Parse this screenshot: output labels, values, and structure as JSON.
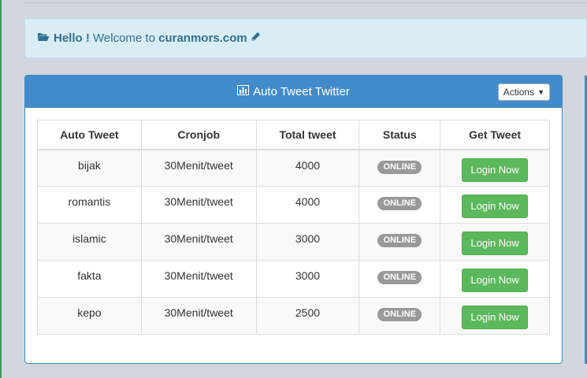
{
  "alert": {
    "hello": "Hello !",
    "welcome": "Welcome to",
    "site": "curanmors.com"
  },
  "panel": {
    "title": "Auto Tweet Twitter",
    "actions_label": "Actions"
  },
  "table": {
    "headers": [
      "Auto Tweet",
      "Cronjob",
      "Total tweet",
      "Status",
      "Get Tweet"
    ],
    "rows": [
      {
        "name": "bijak",
        "cron": "30Menit/tweet",
        "total": "4000",
        "status": "ONLINE",
        "action": "Login Now"
      },
      {
        "name": "romantis",
        "cron": "30Menit/tweet",
        "total": "4000",
        "status": "ONLINE",
        "action": "Login Now"
      },
      {
        "name": "islamic",
        "cron": "30Menit/tweet",
        "total": "3000",
        "status": "ONLINE",
        "action": "Login Now"
      },
      {
        "name": "fakta",
        "cron": "30Menit/tweet",
        "total": "3000",
        "status": "ONLINE",
        "action": "Login Now"
      },
      {
        "name": "kepo",
        "cron": "30Menit/tweet",
        "total": "2500",
        "status": "ONLINE",
        "action": "Login Now"
      }
    ]
  },
  "colors": {
    "heading": "#428bca",
    "success": "#5cb85c",
    "badge": "#999999",
    "alert_bg": "#d9edf7"
  }
}
